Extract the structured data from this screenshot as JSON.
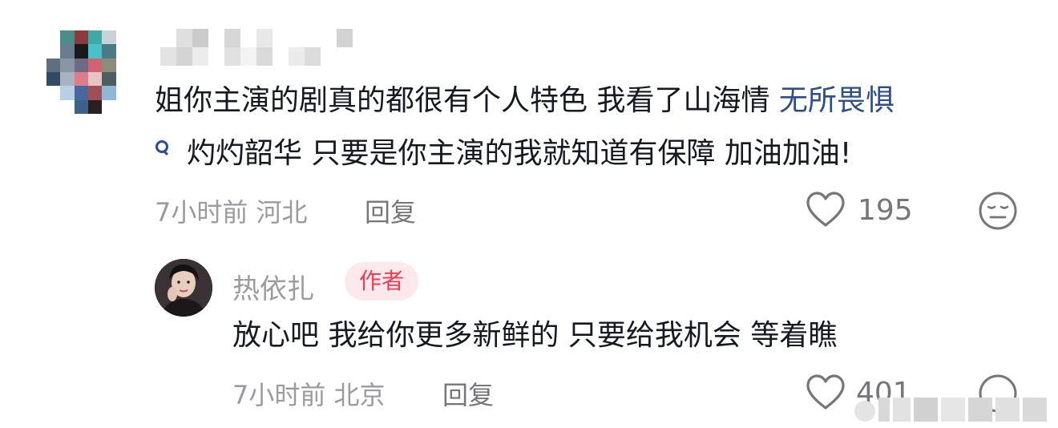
{
  "comment": {
    "text_line1_prefix": "姐你主演的剧真的都很有个人特色 我看了山海情 ",
    "text_line1_link": "无所畏惧",
    "text_line2": "灼灼韶华 只要是你主演的我就知道有保障 加油加油!",
    "time_location": "7小时前 河北",
    "reply_label": "回复",
    "like_count": "195"
  },
  "reply": {
    "author": "热依扎",
    "badge": "作者",
    "text": "放心吧 我给你更多新鲜的 只要给我机会 等着瞧",
    "time_location": "7小时前 北京",
    "reply_label": "回复",
    "like_count": "401"
  },
  "colors": {
    "link": "#2b4e8d",
    "badge_text": "#f03d55",
    "badge_bg": "#fde9ec",
    "meta_gray": "#9a9ba0"
  },
  "icons": [
    "search-icon",
    "heart-icon",
    "face-emoji-icon"
  ]
}
